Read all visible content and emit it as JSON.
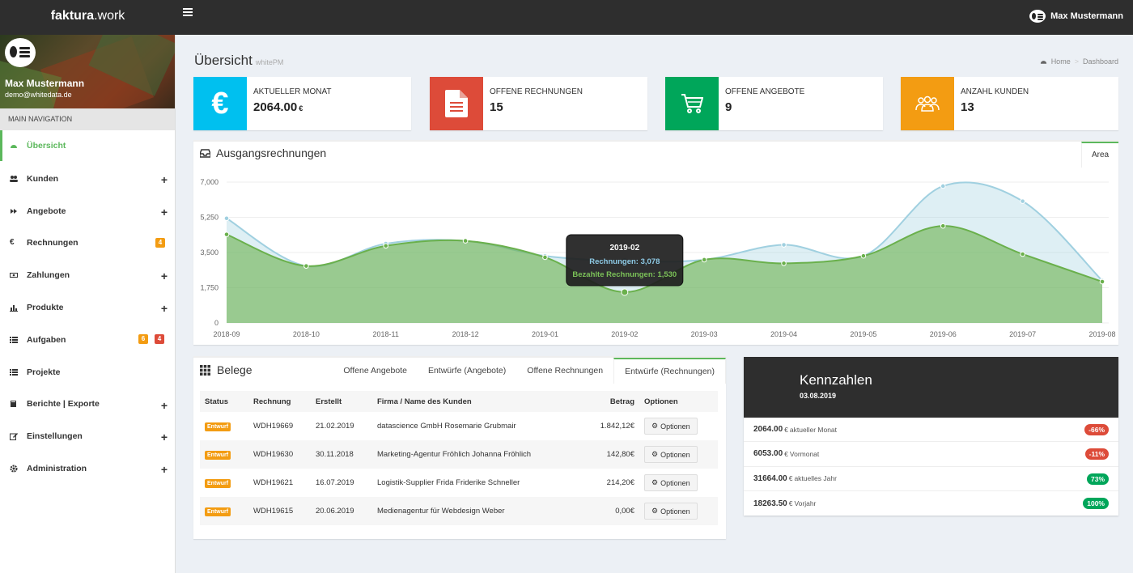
{
  "app": {
    "brand_bold": "faktura",
    "brand_rest": ".work"
  },
  "topbar": {
    "user_name": "Max Mustermann"
  },
  "sidebar": {
    "user_name": "Max Mustermann",
    "user_email": "demo@whitedata.de",
    "nav_header": "MAIN NAVIGATION",
    "items": [
      {
        "label": "Übersicht",
        "icon": "dashboard-icon"
      },
      {
        "label": "Kunden",
        "icon": "users-icon"
      },
      {
        "label": "Angebote",
        "icon": "forward-icon"
      },
      {
        "label": "Rechnungen",
        "icon": "euro-icon",
        "badge": "4"
      },
      {
        "label": "Zahlungen",
        "icon": "money-icon"
      },
      {
        "label": "Produkte",
        "icon": "bar-chart-icon"
      },
      {
        "label": "Aufgaben",
        "icon": "list-icon",
        "badge1": "6",
        "badge2": "4"
      },
      {
        "label": "Projekte",
        "icon": "list-icon"
      },
      {
        "label": "Berichte | Exporte",
        "icon": "book-icon"
      },
      {
        "label": "Einstellungen",
        "icon": "edit-icon"
      },
      {
        "label": "Administration",
        "icon": "gear-icon"
      }
    ]
  },
  "header": {
    "title": "Übersicht",
    "subtitle": "whitePM",
    "breadcrumb_home": "Home",
    "breadcrumb_current": "Dashboard"
  },
  "info_boxes": [
    {
      "label": "AKTUELLER MONAT",
      "value": "2064.00",
      "unit": "€",
      "color": "#00c0ef",
      "icon": "euro-icon"
    },
    {
      "label": "OFFENE RECHNUNGEN",
      "value": "15",
      "color": "#dd4b39",
      "icon": "file-icon"
    },
    {
      "label": "OFFENE ANGEBOTE",
      "value": "9",
      "color": "#00a65a",
      "icon": "cart-icon"
    },
    {
      "label": "ANZAHL KUNDEN",
      "value": "13",
      "color": "#f39c12",
      "icon": "users-icon"
    }
  ],
  "chart_panel": {
    "title": "Ausgangsrechnungen",
    "tab": "Area"
  },
  "chart_data": {
    "type": "area",
    "categories": [
      "2018-09",
      "2018-10",
      "2018-11",
      "2018-12",
      "2019-01",
      "2019-02",
      "2019-03",
      "2019-04",
      "2019-05",
      "2019-06",
      "2019-07",
      "2019-08"
    ],
    "series": [
      {
        "name": "Rechnungen",
        "values": [
          5200,
          2830,
          3940,
          4080,
          3330,
          3078,
          3140,
          3880,
          3330,
          6800,
          6050,
          2100
        ],
        "color": "#a0d0e0"
      },
      {
        "name": "Bezahlte Rechnungen",
        "values": [
          4400,
          2830,
          3830,
          4080,
          3260,
          1530,
          3140,
          2960,
          3330,
          4820,
          3420,
          2050
        ],
        "color": "#6ab04c"
      }
    ],
    "yticks": [
      "0",
      "1,750",
      "3,500",
      "5,250",
      "7,000"
    ],
    "ylim": [
      0,
      7000
    ],
    "grid": true,
    "tooltip": {
      "title": "2019-02",
      "line1": "Rechnungen: 3,078",
      "line2": "Bezahlte Rechnungen: 1,530"
    }
  },
  "belege": {
    "title": "Belege",
    "tabs": [
      "Offene Angebote",
      "Entwürfe (Angebote)",
      "Offene Rechnungen",
      "Entwürfe (Rechnungen)"
    ],
    "columns": [
      "Status",
      "Rechnung",
      "Erstellt",
      "Firma / Name des Kunden",
      "Betrag",
      "Optionen"
    ],
    "rows": [
      {
        "status": "Entwurf",
        "nr": "WDH19669",
        "date": "21.02.2019",
        "name": "datascience GmbH Rosemarie Grubmair",
        "amount": "1.842,12€",
        "opt": "Optionen"
      },
      {
        "status": "Entwurf",
        "nr": "WDH19630",
        "date": "30.11.2018",
        "name": "Marketing-Agentur Fröhlich Johanna Fröhlich",
        "amount": "142,80€",
        "opt": "Optionen"
      },
      {
        "status": "Entwurf",
        "nr": "WDH19621",
        "date": "16.07.2019",
        "name": "Logistik-Supplier Frida Friderike Schneller",
        "amount": "214,20€",
        "opt": "Optionen"
      },
      {
        "status": "Entwurf",
        "nr": "WDH19615",
        "date": "20.06.2019",
        "name": "Medienagentur für Webdesign Weber",
        "amount": "0,00€",
        "opt": "Optionen"
      }
    ]
  },
  "kennzahlen": {
    "title": "Kennzahlen",
    "date": "03.08.2019",
    "rows": [
      {
        "value": "2064.00",
        "unit": "€",
        "label": "aktueller Monat",
        "badge": "-66%",
        "color": "#dd4b39"
      },
      {
        "value": "6053.00",
        "unit": "€",
        "label": "Vormonat",
        "badge": "-11%",
        "color": "#dd4b39"
      },
      {
        "value": "31664.00",
        "unit": "€",
        "label": "aktuelles Jahr",
        "badge": "73%",
        "color": "#00a65a"
      },
      {
        "value": "18263.50",
        "unit": "€",
        "label": "Vorjahr",
        "badge": "100%",
        "color": "#00a65a"
      }
    ]
  }
}
